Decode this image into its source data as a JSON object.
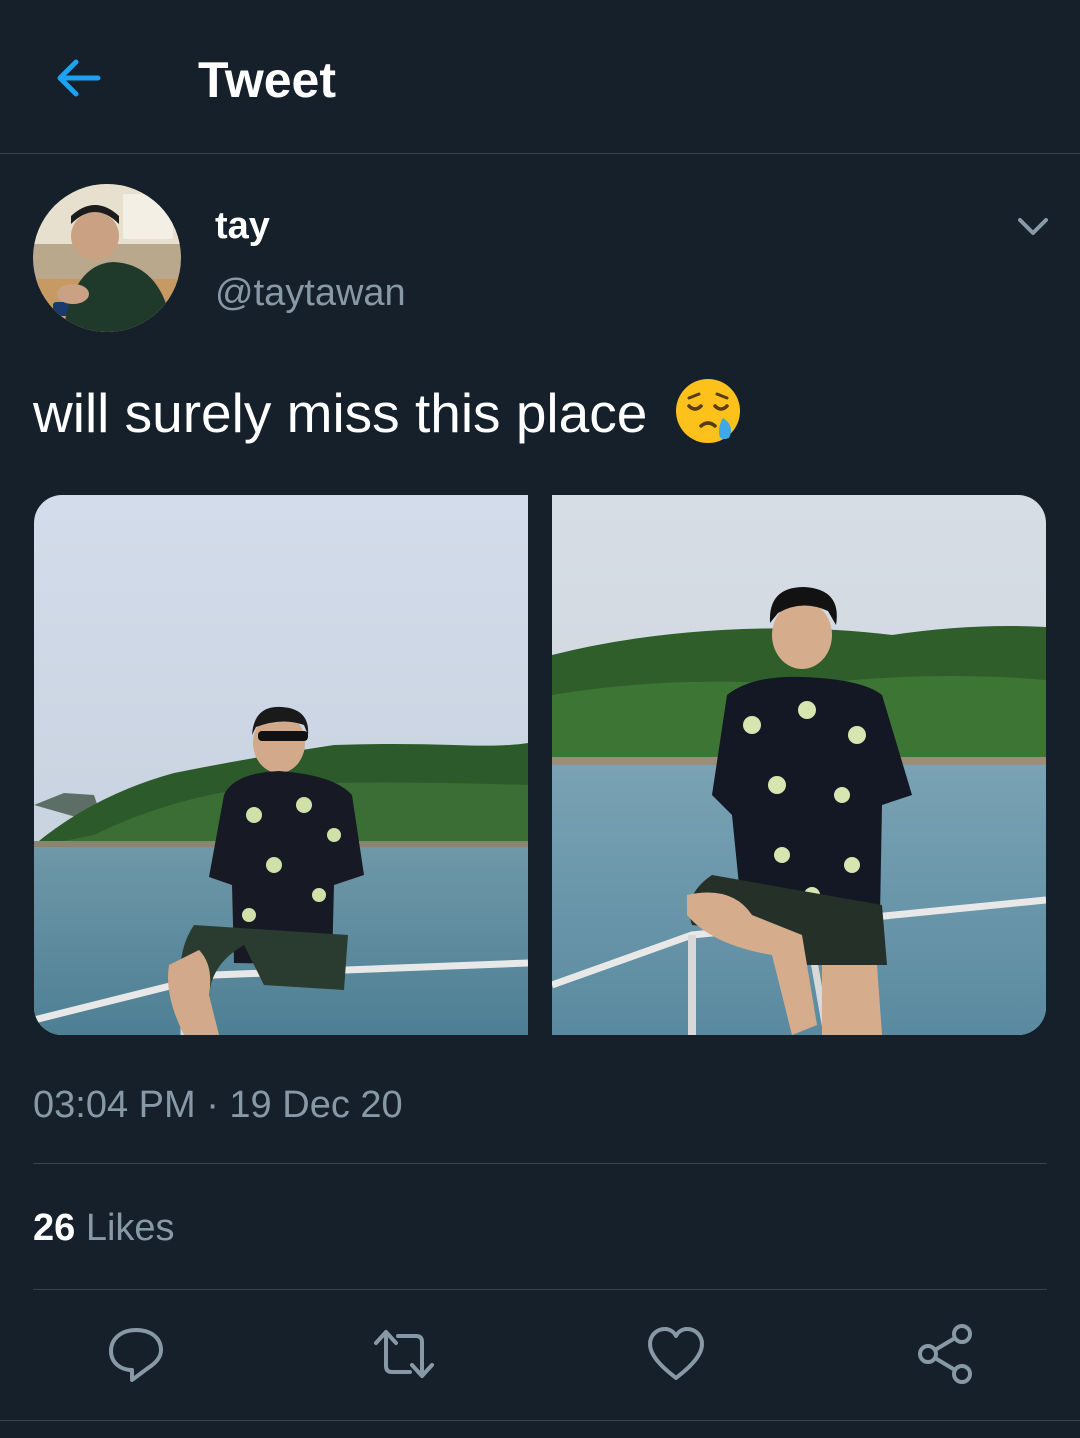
{
  "header": {
    "title": "Tweet",
    "back_icon": "arrow-left-icon"
  },
  "author": {
    "display_name": "tay",
    "handle": "@taytawan"
  },
  "tweet": {
    "text": "will surely miss this place",
    "emoji": "sleepy-face-emoji",
    "timestamp": "03:04 PM · 19 Dec 20",
    "likes_count": "26",
    "likes_label": " Likes"
  },
  "actions": [
    "reply-icon",
    "retweet-icon",
    "like-icon",
    "share-icon"
  ],
  "colors": {
    "background": "#15202b",
    "accent": "#1da1f2",
    "secondary_text": "#8899a6",
    "border": "#38444d"
  }
}
